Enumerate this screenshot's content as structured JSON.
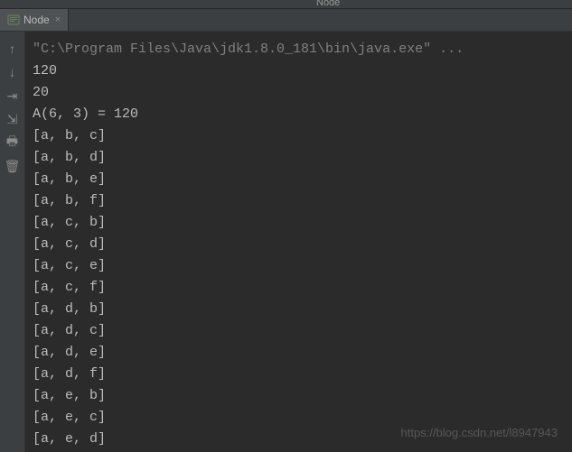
{
  "topTitle": "Node",
  "tab": {
    "label": "Node",
    "closeGlyph": "×"
  },
  "gutterIcons": {
    "up": "↑",
    "down": "↓",
    "wrap": "⇥",
    "filter": "⇲",
    "print": "🖶",
    "trash": "🗑"
  },
  "console": {
    "cmd": "\"C:\\Program Files\\Java\\jdk1.8.0_181\\bin\\java.exe\" ...",
    "lines": [
      "120",
      "20",
      "A(6, 3) = 120",
      "[a, b, c]",
      "[a, b, d]",
      "[a, b, e]",
      "[a, b, f]",
      "[a, c, b]",
      "[a, c, d]",
      "[a, c, e]",
      "[a, c, f]",
      "[a, d, b]",
      "[a, d, c]",
      "[a, d, e]",
      "[a, d, f]",
      "[a, e, b]",
      "[a, e, c]",
      "[a, e, d]"
    ]
  },
  "watermark": "https://blog.csdn.net/l8947943"
}
